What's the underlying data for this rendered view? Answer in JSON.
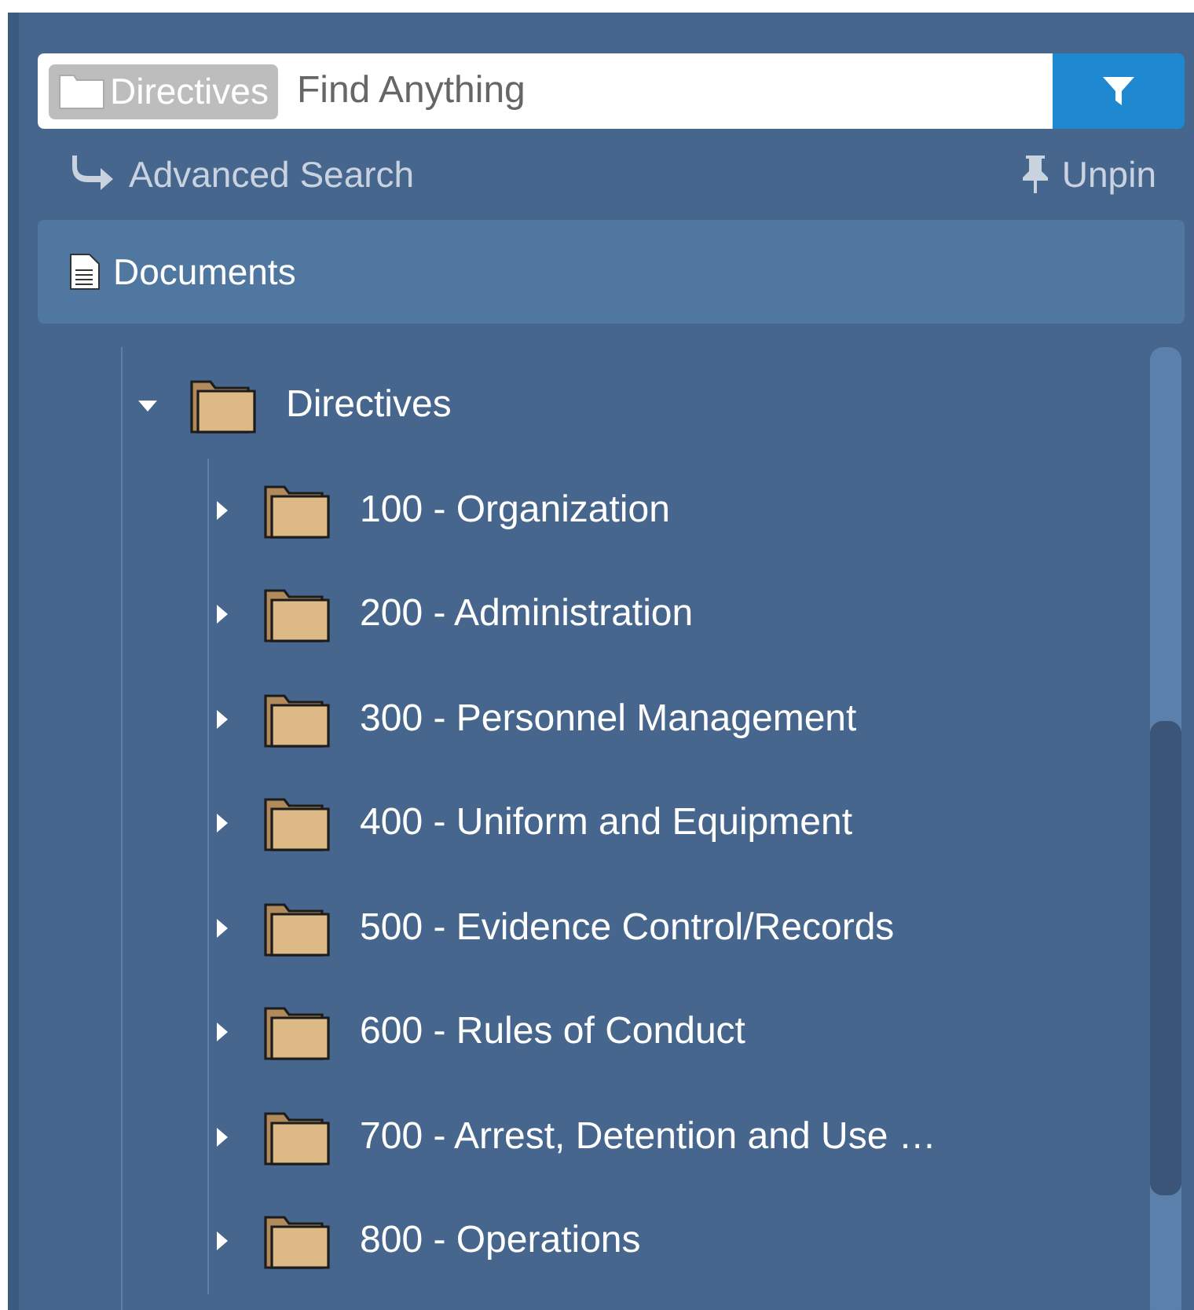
{
  "search": {
    "scope_tag": "Directives",
    "placeholder": "Find Anything"
  },
  "links": {
    "advanced_search": "Advanced Search",
    "unpin": "Unpin"
  },
  "section": {
    "label": "Documents"
  },
  "tree": [
    {
      "label": "Directives",
      "expanded": true,
      "children": [
        {
          "label": "100 - Organization",
          "expanded": false
        },
        {
          "label": "200 - Administration",
          "expanded": false
        },
        {
          "label": "300 - Personnel Management",
          "expanded": false
        },
        {
          "label": "400 - Uniform and Equipment",
          "expanded": false
        },
        {
          "label": "500 - Evidence Control/Records",
          "expanded": false
        },
        {
          "label": "600 - Rules of Conduct",
          "expanded": false
        },
        {
          "label": "700 - Arrest, Detention and Use …",
          "expanded": false
        },
        {
          "label": "800 - Operations",
          "expanded": false
        }
      ]
    }
  ]
}
